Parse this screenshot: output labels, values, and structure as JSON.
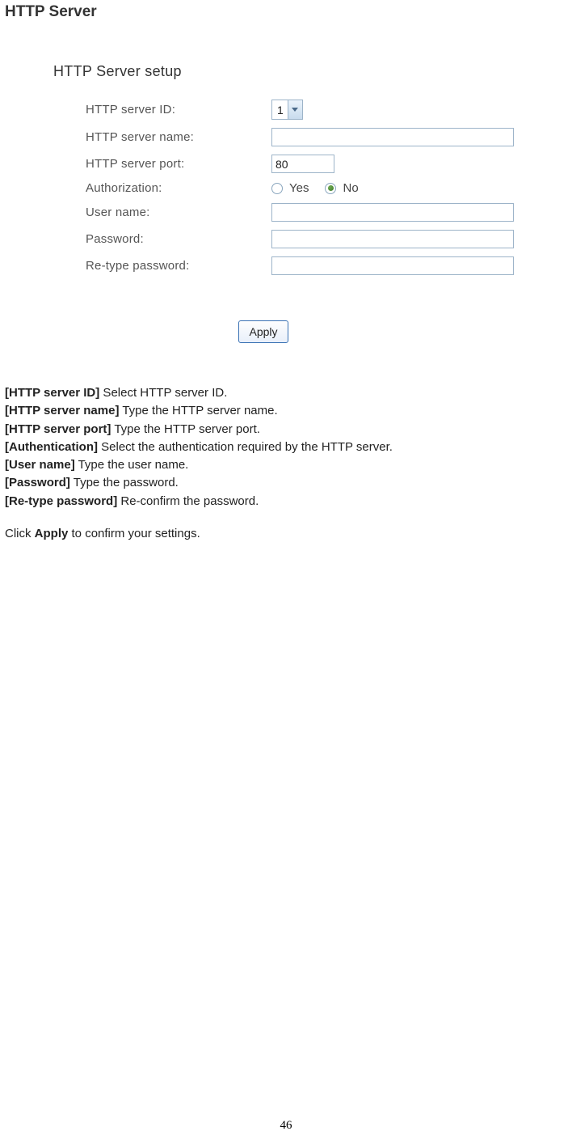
{
  "title": "HTTP Server",
  "panel": {
    "heading": "HTTP Server setup",
    "fields": {
      "id_label": "HTTP server ID:",
      "id_value": "1",
      "name_label": "HTTP server name:",
      "name_value": "",
      "port_label": "HTTP server port:",
      "port_value": "80",
      "auth_label": "Authorization:",
      "auth_yes": "Yes",
      "auth_no": "No",
      "auth_selected": "no",
      "user_label": "User name:",
      "user_value": "",
      "pass_label": "Password:",
      "pass_value": "",
      "repass_label": "Re-type password:",
      "repass_value": ""
    },
    "apply_label": "Apply"
  },
  "descriptions": {
    "items": [
      {
        "label": "[HTTP server ID]",
        "text": " Select HTTP server ID."
      },
      {
        "label": "[HTTP server name]",
        "text": " Type the HTTP server name."
      },
      {
        "label": "[HTTP server port]",
        "text": " Type the HTTP server port."
      },
      {
        "label": "[Authentication]",
        "text": " Select the authentication required by the HTTP server."
      },
      {
        "label": "[User name]",
        "text": " Type the user name."
      },
      {
        "label": "[Password]",
        "text": " Type the password."
      },
      {
        "label": "[Re-type password]",
        "text": " Re-confirm the password."
      }
    ],
    "apply_note_pre": "Click ",
    "apply_note_bold": "Apply",
    "apply_note_post": " to confirm your settings."
  },
  "page_number": "46"
}
